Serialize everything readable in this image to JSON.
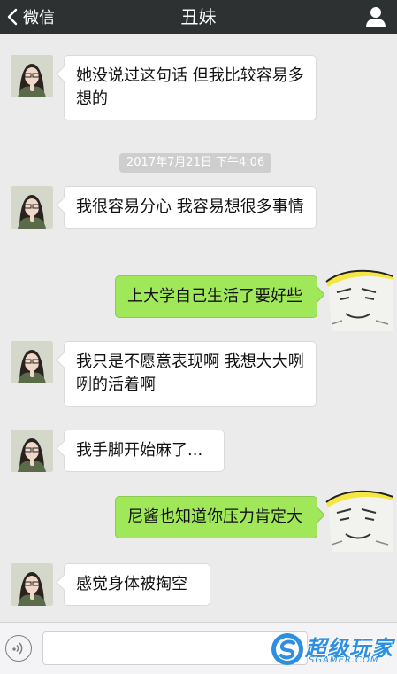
{
  "nav": {
    "back_label": "微信",
    "title": "丑妹",
    "icons": {
      "back": "chevron-left-icon",
      "profile": "person-icon"
    }
  },
  "messages": [
    {
      "side": "left",
      "text": "她没说过这句话 但我比较容易多想的"
    },
    {
      "type": "timestamp",
      "text": "2017年7月21日 下午4:06"
    },
    {
      "side": "left",
      "text": "我很容易分心 我容易想很多事情"
    },
    {
      "side": "right",
      "text": "上大学自己生活了要好些"
    },
    {
      "side": "left",
      "text": "我只是不愿意表现啊 我想大大咧咧的活着啊"
    },
    {
      "side": "left",
      "text": "我手脚开始麻了..."
    },
    {
      "side": "right",
      "text": "尼酱也知道你压力肯定大"
    },
    {
      "side": "left",
      "text": "感觉身体被掏空"
    }
  ],
  "input_bar": {
    "icons": {
      "voice": "voice-icon"
    },
    "watermark": {
      "cn": "超级玩家",
      "en": "SGAMER.COM"
    }
  },
  "colors": {
    "nav_bg": "#2e3132",
    "chat_bg": "#ebebeb",
    "outgoing_bubble": "#a0e75a",
    "incoming_bubble": "#ffffff",
    "watermark": "#2e8fe0"
  }
}
